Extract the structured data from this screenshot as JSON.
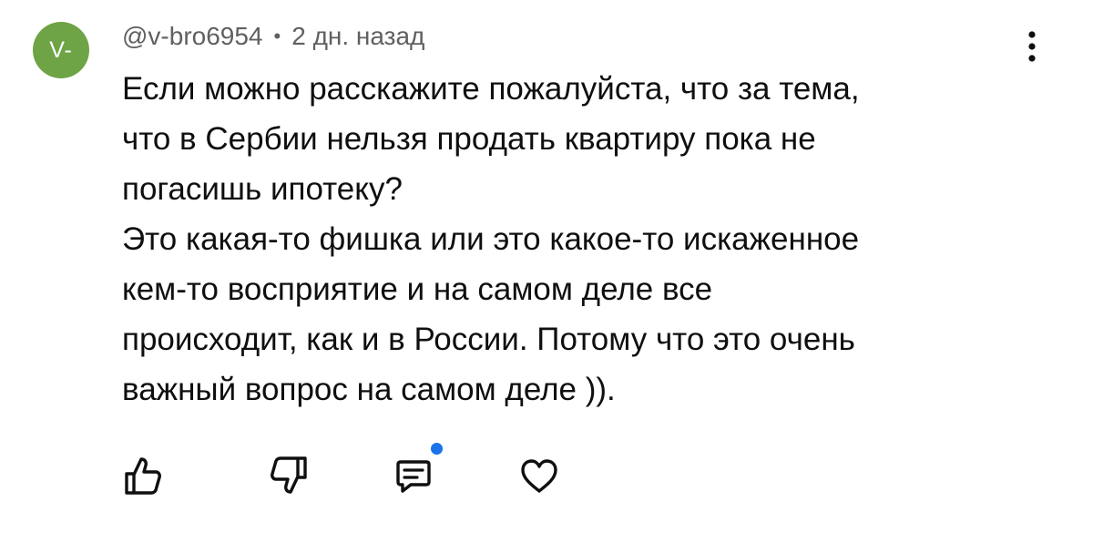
{
  "comment": {
    "avatar_text": "V-",
    "avatar_color": "#6ea445",
    "author": "@v-bro6954",
    "separator": "•",
    "time": "2 дн. назад",
    "lines": [
      "Если можно расскажите пожалуйста, что за тема,",
      "что в Сербии нельзя продать квартиру пока не",
      "погасишь ипотеку?",
      "Это какая-то фишка или это какое-то искаженное",
      "кем-то восприятие и на самом деле все",
      "происходит, как и в России. Потому что это очень",
      "важный вопрос на самом деле ))."
    ]
  },
  "actions": {
    "icons": [
      "thumbs-up-icon",
      "thumbs-down-icon",
      "reply-icon",
      "heart-icon",
      "more-vertical-icon"
    ],
    "badge_color": "#1a73e8"
  }
}
